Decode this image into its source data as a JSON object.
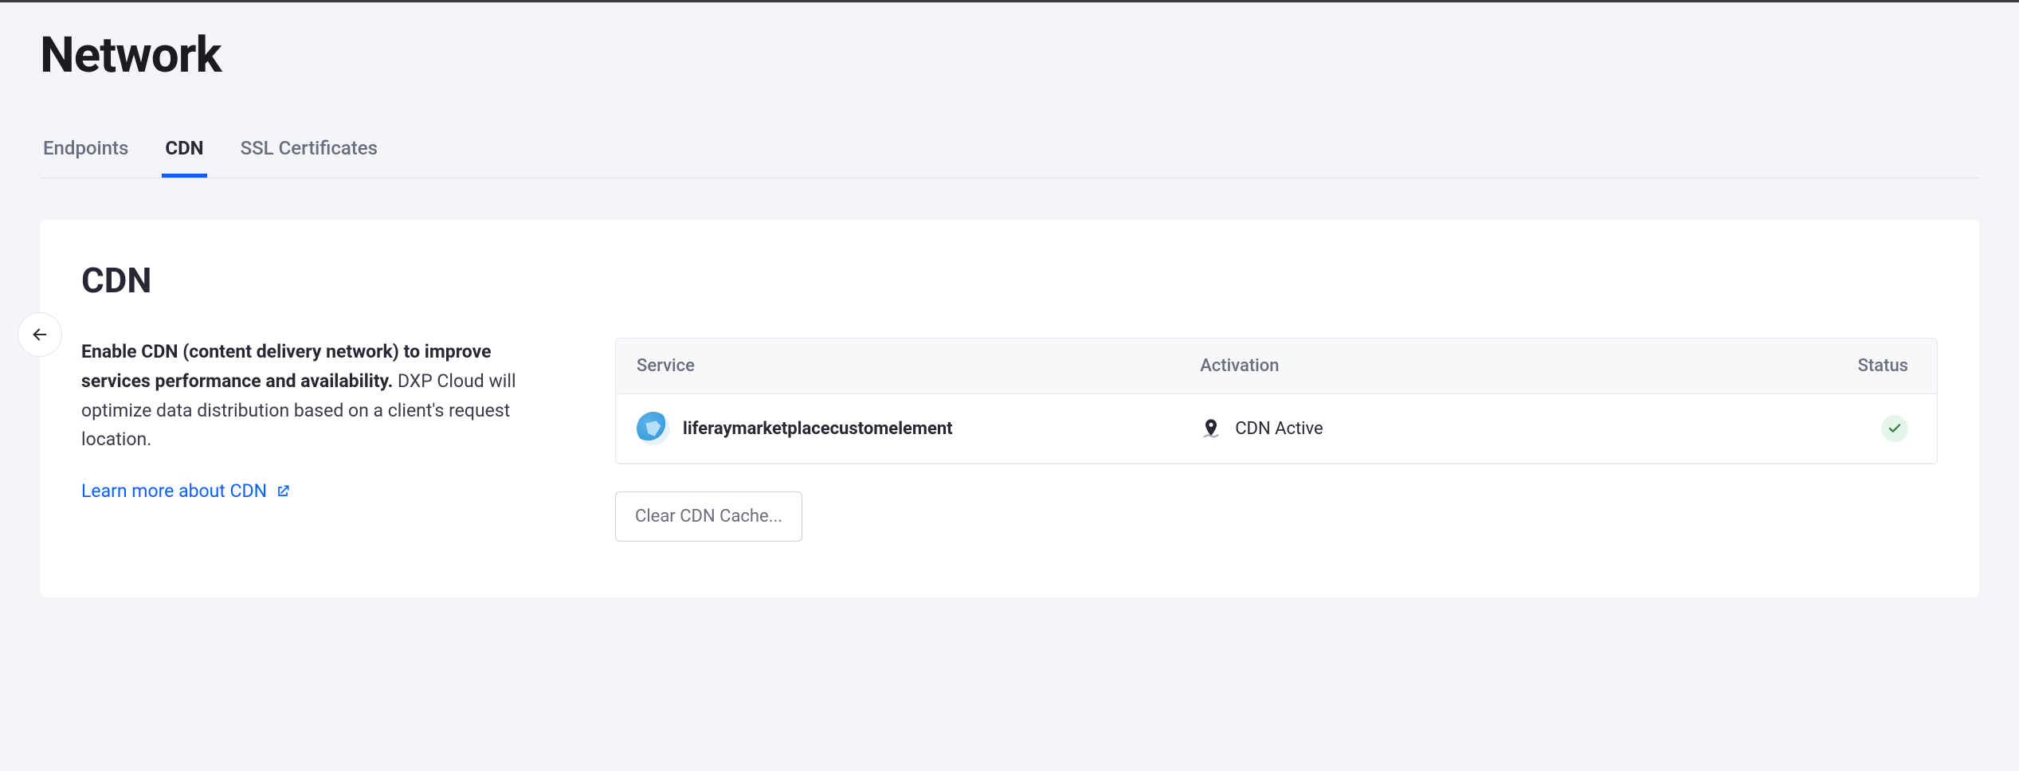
{
  "page": {
    "title": "Network"
  },
  "tabs": [
    {
      "label": "Endpoints",
      "active": false
    },
    {
      "label": "CDN",
      "active": true
    },
    {
      "label": "SSL Certificates",
      "active": false
    }
  ],
  "card": {
    "title": "CDN",
    "description_bold": "Enable CDN (content delivery network) to improve services performance and availability.",
    "description_rest": " DXP Cloud will optimize data distribution based on a client's request location.",
    "learn_more_label": "Learn more about CDN",
    "clear_cache_label": "Clear CDN Cache..."
  },
  "table": {
    "headers": {
      "service": "Service",
      "activation": "Activation",
      "status": "Status"
    },
    "rows": [
      {
        "service": "liferaymarketplacecustomelement",
        "activation": "CDN Active",
        "status": "ok"
      }
    ]
  }
}
